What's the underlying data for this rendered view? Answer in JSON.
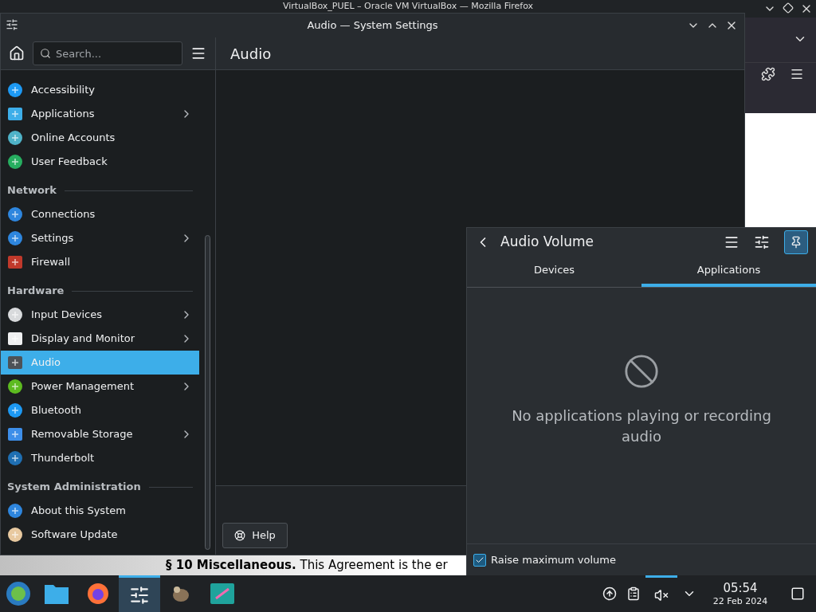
{
  "firefox": {
    "title": "VirtualBox_PUEL – Oracle VM VirtualBox — Mozilla Firefox",
    "footer_text": "**§ 10 Miscellaneous.** This Agreement is the er"
  },
  "settings": {
    "title": "Audio — System Settings",
    "search": {
      "placeholder": "Search..."
    },
    "page_title": "Audio",
    "help_button": "Help",
    "sections": [
      {
        "items": [
          {
            "label": "Accessibility",
            "has_children": false,
            "selected": false
          },
          {
            "label": "Applications",
            "has_children": true,
            "selected": false
          },
          {
            "label": "Online Accounts",
            "has_children": false,
            "selected": false
          },
          {
            "label": "User Feedback",
            "has_children": false,
            "selected": false
          }
        ]
      },
      {
        "header": "Network",
        "items": [
          {
            "label": "Connections",
            "has_children": false,
            "selected": false
          },
          {
            "label": "Settings",
            "has_children": true,
            "selected": false
          },
          {
            "label": "Firewall",
            "has_children": false,
            "selected": false
          }
        ]
      },
      {
        "header": "Hardware",
        "items": [
          {
            "label": "Input Devices",
            "has_children": true,
            "selected": false
          },
          {
            "label": "Display and Monitor",
            "has_children": true,
            "selected": false
          },
          {
            "label": "Audio",
            "has_children": false,
            "selected": true
          },
          {
            "label": "Power Management",
            "has_children": true,
            "selected": false
          },
          {
            "label": "Bluetooth",
            "has_children": false,
            "selected": false
          },
          {
            "label": "Removable Storage",
            "has_children": true,
            "selected": false
          },
          {
            "label": "Thunderbolt",
            "has_children": false,
            "selected": false
          }
        ]
      },
      {
        "header": "System Administration",
        "items": [
          {
            "label": "About this System",
            "has_children": false,
            "selected": false
          },
          {
            "label": "Software Update",
            "has_children": false,
            "selected": false
          }
        ]
      }
    ]
  },
  "popup": {
    "title": "Audio Volume",
    "pinned": true,
    "tabs": [
      {
        "label": "Devices",
        "selected": false
      },
      {
        "label": "Applications",
        "selected": true
      }
    ],
    "empty_message": "No applications playing or recording audio",
    "raise_max": {
      "label": "Raise maximum volume",
      "checked": true
    }
  },
  "taskbar": {
    "apps": [
      {
        "selected": false
      },
      {
        "selected": false
      },
      {
        "selected": false
      },
      {
        "selected": true
      },
      {
        "selected": false
      },
      {
        "selected": false
      }
    ],
    "tray": [
      {
        "selected": false
      },
      {
        "selected": false
      },
      {
        "selected": true
      },
      {
        "selected": false
      }
    ],
    "clock": {
      "time": "05:54",
      "date": "22 Feb 2024"
    }
  }
}
